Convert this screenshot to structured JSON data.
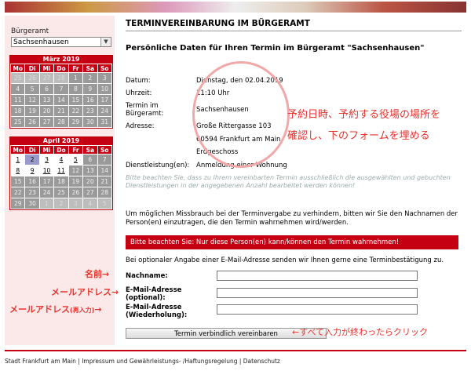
{
  "sidebar": {
    "label": "Bürgeramt",
    "select_value": "Sachsenhausen",
    "calendar_march": {
      "title": "März 2019",
      "days": [
        "Mo",
        "Di",
        "Mi",
        "Do",
        "Fr",
        "Sa",
        "So"
      ],
      "rows": [
        [
          "25",
          "26",
          "27",
          "28",
          "1",
          "2",
          "3"
        ],
        [
          "4",
          "5",
          "6",
          "7",
          "8",
          "9",
          "10"
        ],
        [
          "11",
          "12",
          "13",
          "14",
          "15",
          "16",
          "17"
        ],
        [
          "18",
          "19",
          "20",
          "21",
          "22",
          "23",
          "24"
        ],
        [
          "25",
          "26",
          "27",
          "28",
          "29",
          "30",
          "31"
        ]
      ]
    },
    "calendar_april": {
      "title": "April 2019",
      "days": [
        "Mo",
        "Di",
        "Mi",
        "Do",
        "Fr",
        "Sa",
        "So"
      ],
      "rows": [
        [
          "1",
          "2",
          "3",
          "4",
          "5",
          "6",
          "7"
        ],
        [
          "8",
          "9",
          "10",
          "11",
          "12",
          "13",
          "14"
        ],
        [
          "15",
          "16",
          "17",
          "18",
          "19",
          "20",
          "21"
        ],
        [
          "22",
          "23",
          "24",
          "25",
          "26",
          "27",
          "28"
        ],
        [
          "29",
          "30",
          "1",
          "2",
          "3",
          "4",
          "5"
        ]
      ]
    }
  },
  "main": {
    "title": "TERMINVEREINBARUNG IM BÜRGERAMT",
    "subtitle": "Persönliche Daten für Ihren Termin im Bürgeramt \"Sachsenhausen\"",
    "details": {
      "datum_label": "Datum:",
      "datum_value": "Dienstag, den 02.04.2019",
      "uhrzeit_label": "Uhrzeit:",
      "uhrzeit_value": "11:10 Uhr",
      "termin_label_1": "Termin im",
      "termin_label_2": "Bürgeramt:",
      "termin_value": "Sachsenhausen",
      "adresse_label": "Adresse:",
      "adresse_line1": "Große Rittergasse 103",
      "adresse_line2": "60594 Frankfurt am Main",
      "adresse_line3": "Erdgeschoss",
      "dienst_label": "Dienstleistung(en):",
      "dienst_value": "Anmeldung einer Wohnung"
    },
    "note": "Bitte beachten Sie, dass zu Ihrem vereinbarten Termin ausschließlich die ausgewählten und gebuchten Dienstleistungen in der angegebenen Anzahl bearbeitet werden können!",
    "missbrauch_text": "Um möglichen Missbrauch bei der Terminvergabe zu verhindern, bitten wir Sie den Nachnamen der Person(en) einzutragen, die den Termin wahrnehmen wird/werden.",
    "warning": "Bitte beachten Sie: Nur diese Person(en) kann/können den Termin wahrnehmen!",
    "email_text": "Bei optionaler Angabe einer E-Mail-Adresse senden wir Ihnen gerne eine Terminbestätigung zu.",
    "form": {
      "nachname_label": "Nachname:",
      "email_label_1": "E-Mail-Adresse",
      "email_label_2": "(optional):",
      "email2_label_1": "E-Mail-Adresse",
      "email2_label_2": "(Wiederholung):"
    },
    "submit_label": "Termin verbindlich vereinbaren"
  },
  "annotations": {
    "confirm_line1": "予約日時、予約する役場の場所を",
    "confirm_line2": "確認し、下のフォームを埋める",
    "name": "名前→",
    "email": "メールアドレス→",
    "email_repeat_main": "メールアドレス",
    "email_repeat_sub": "(再入力)",
    "email_repeat_arrow": "→",
    "click": "←すべて入力が終わったらクリック"
  },
  "footer": {
    "text": "Stadt Frankfurt am Main | Impressum und Gewährleistungs- /Haftungsregelung | Datenschutz"
  },
  "colors": {
    "accent_red": "#c40012",
    "annotation_red": "#e8322b",
    "sidebar_bg": "#fbe9ea"
  }
}
